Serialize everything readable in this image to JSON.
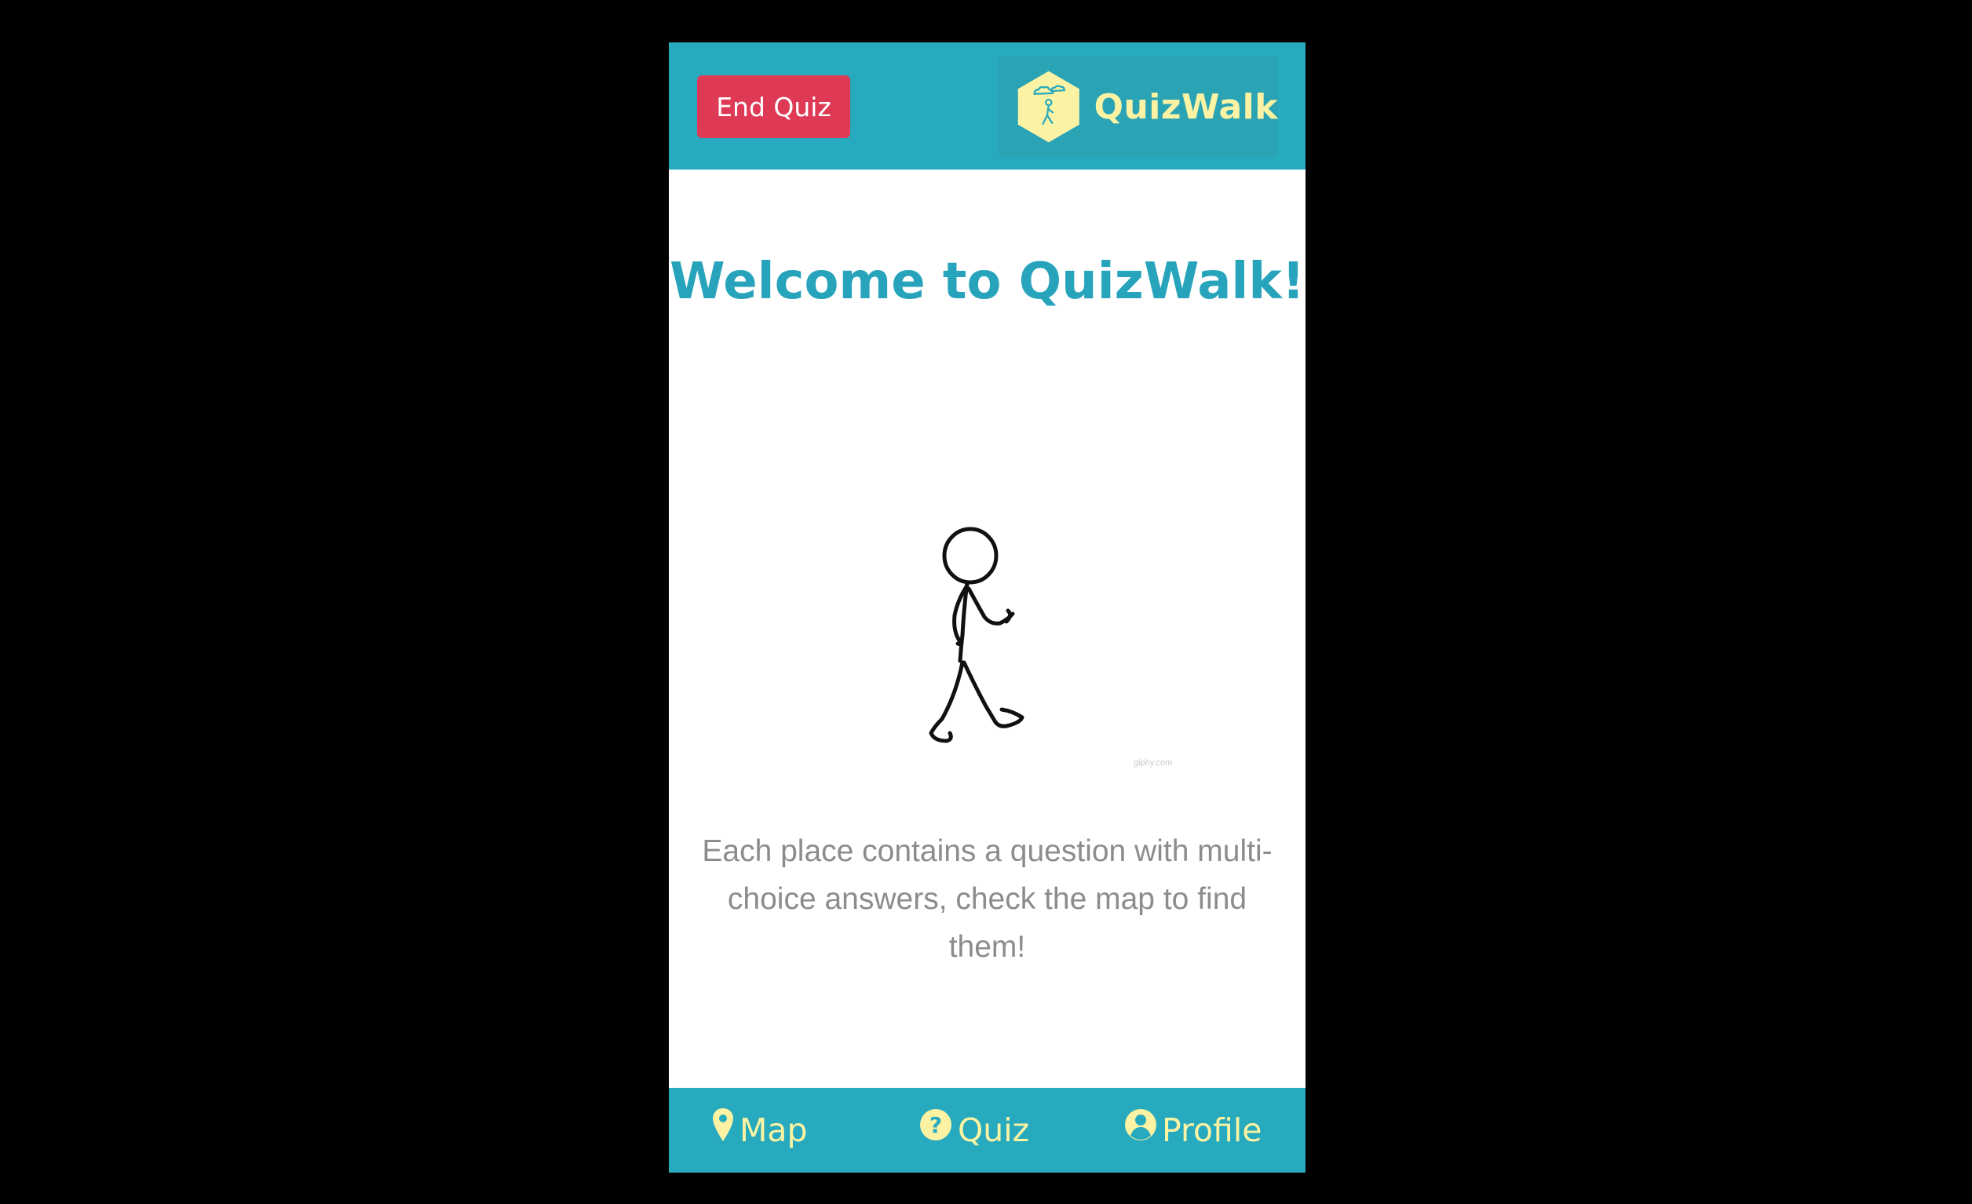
{
  "header": {
    "end_quiz_label": "End Quiz",
    "logo_text": "QuizWalk",
    "logo_icon": "walking-person-hexagon-icon"
  },
  "main": {
    "title": "Welcome to QuizWalk!",
    "illustration": "walking-stick-figure",
    "watermark": "giphy.com",
    "description": "Each place contains a question with multi-choice answers, check the map to find them!"
  },
  "bottom_nav": {
    "items": [
      {
        "label": "Map",
        "icon": "map-pin-icon"
      },
      {
        "label": "Quiz",
        "icon": "question-circle-icon"
      },
      {
        "label": "Profile",
        "icon": "user-circle-icon"
      }
    ]
  },
  "colors": {
    "primary": "#27aabe",
    "danger": "#de3a55",
    "accent_yellow": "#fbf3a3",
    "title_text": "#27a4bb",
    "body_text": "#8c8c8c",
    "background": "#000000"
  }
}
